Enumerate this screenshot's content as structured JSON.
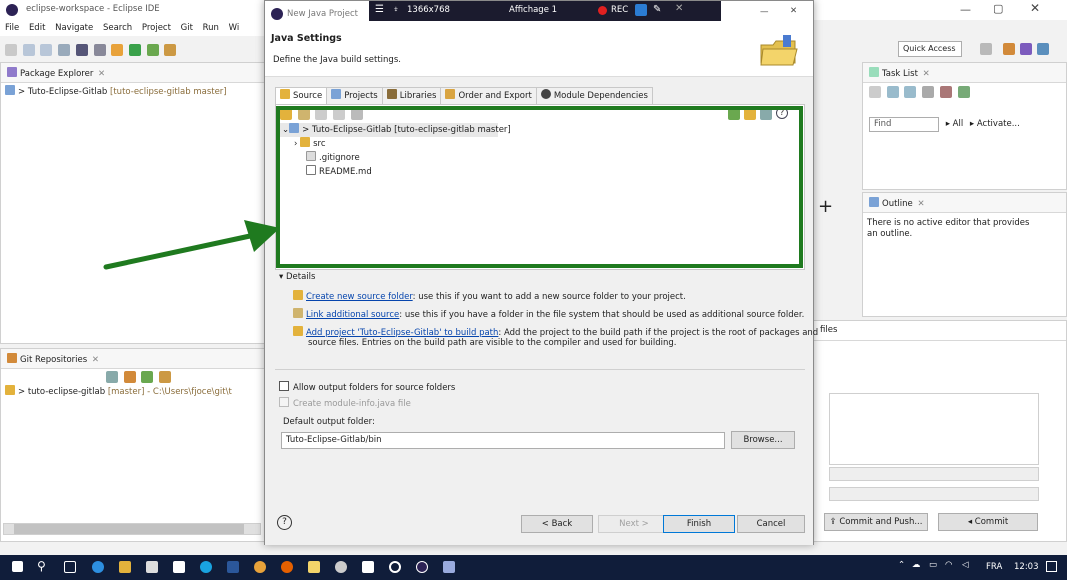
{
  "eclipse": {
    "window_title": "eclipse-workspace - Eclipse IDE",
    "menu": [
      "File",
      "Edit",
      "Navigate",
      "Search",
      "Project",
      "Git",
      "Run",
      "Wi"
    ],
    "quick_access": "Quick Access",
    "package_explorer": {
      "title": "Package Explorer",
      "item": "> Tuto-Eclipse-Gitlab",
      "item_branch": "[tuto-eclipse-gitlab master]"
    },
    "git_repos": {
      "title": "Git Repositories",
      "item": "> tuto-eclipse-gitlab",
      "item_branch": "[master] - C:\\Users\\fjoce\\git\\t"
    },
    "task_list": {
      "title": "Task List",
      "find_placeholder": "Find",
      "all": "All",
      "activate": "Activate..."
    },
    "outline": {
      "title": "Outline",
      "message": "There is no active editor that provides an outline."
    },
    "staging": {
      "files_label": "files",
      "commit_push": "Commit and Push...",
      "commit": "Commit"
    }
  },
  "recorder": {
    "resolution": "1366x768",
    "display": "Affichage 1",
    "rec": "REC"
  },
  "dialog": {
    "title": "New Java Project",
    "heading": "Java Settings",
    "subheading": "Define the Java build settings.",
    "tabs": [
      "Source",
      "Projects",
      "Libraries",
      "Order and Export",
      "Module Dependencies"
    ],
    "tree": {
      "root": "> Tuto-Eclipse-Gitlab [tuto-eclipse-gitlab master]",
      "children": [
        "src",
        ".gitignore",
        "README.md"
      ]
    },
    "details": {
      "label": "Details",
      "create_link": "Create new source folder",
      "create_text": ": use this if you want to add a new source folder to your project.",
      "link_link": "Link additional source",
      "link_text": ": use this if you have a folder in the file system that should be used as additional source folder.",
      "add_link": "Add project 'Tuto-Eclipse-Gitlab' to build path",
      "add_text": ": Add the project to the build path if the project is the root of packages and",
      "add_text2": "source files. Entries on the build path are visible to the compiler and used for building."
    },
    "allow_output": "Allow output folders for source folders",
    "create_module": "Create module-info.java file",
    "default_output_label": "Default output folder:",
    "default_output_value": "Tuto-Eclipse-Gitlab/bin",
    "browse": "Browse...",
    "buttons": {
      "back": "< Back",
      "next": "Next >",
      "finish": "Finish",
      "cancel": "Cancel"
    }
  },
  "taskbar": {
    "lang": "FRA",
    "time": "12:03"
  },
  "colors": {
    "highlight_box": "#1f7a1f",
    "arrow": "#1f7a1f",
    "taskbar": "#101d3a"
  }
}
